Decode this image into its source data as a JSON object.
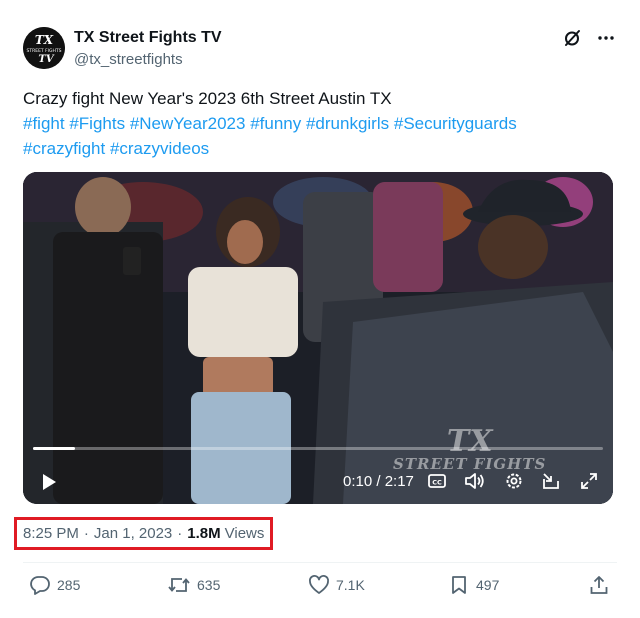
{
  "author": {
    "name": "TX Street Fights TV",
    "handle": "@tx_streetfights",
    "avatar_text_top": "TX",
    "avatar_text_mid": "STREET FIGHTS",
    "avatar_text_bot": "TV"
  },
  "header_icons": [
    "grok-icon",
    "more-icon"
  ],
  "tweet": {
    "line1": "Crazy fight New Year's 2023 6th Street Austin TX",
    "tags": [
      "#fight",
      "#Fights",
      "#NewYear2023",
      "#funny",
      "#drunkgirls",
      "#Securityguards",
      "#crazyfight",
      "#crazyvideos"
    ]
  },
  "video": {
    "watermark_top": "TX",
    "watermark_bottom": "STREET FIGHTS",
    "current_time": "0:10",
    "duration": "2:17",
    "time_label": "0:10 / 2:17",
    "progress": 0.073
  },
  "meta": {
    "time": "8:25 PM",
    "separator": "·",
    "date": "Jan 1, 2023",
    "views_count": "1.8M",
    "views_label": "Views",
    "highlight_color": "#e01b24"
  },
  "actions": {
    "replies": "285",
    "reposts": "635",
    "likes": "7.1K",
    "bookmarks": "497"
  },
  "colors": {
    "link": "#1d9bf0",
    "secondary_text": "#536471",
    "primary_text": "#0f1419"
  }
}
